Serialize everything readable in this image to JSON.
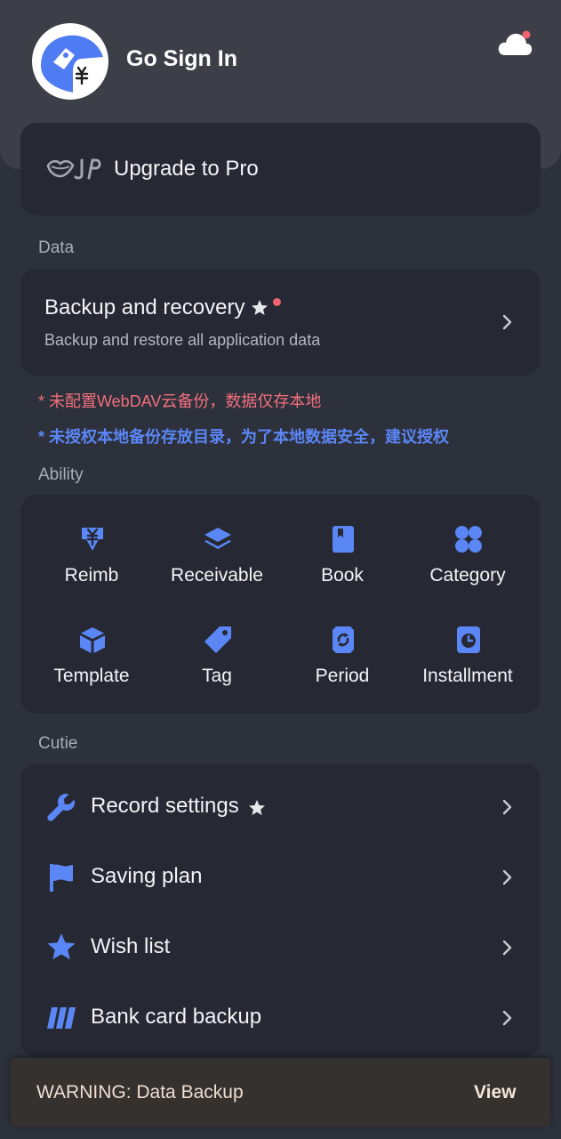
{
  "header": {
    "title": "Go Sign In",
    "avatar_icon": "bird-yen-logo-icon",
    "cloud_icon": "cloud-icon",
    "badge_color": "#f0626f"
  },
  "pro": {
    "label": "Upgrade to Pro",
    "logo_icon": "vip-lips-logo-icon"
  },
  "sections": {
    "data": "Data",
    "ability": "Ability",
    "cutie": "Cutie"
  },
  "backup": {
    "title": "Backup and recovery",
    "subtitle": "Backup and restore all application data"
  },
  "notices": {
    "webdav": "* 未配置WebDAV云备份，数据仅存本地",
    "local": "* 未授权本地备份存放目录，为了本地数据安全，建议授权"
  },
  "ability_items": [
    {
      "label": "Reimb",
      "icon": "yen-down-icon"
    },
    {
      "label": "Receivable",
      "icon": "layers-icon"
    },
    {
      "label": "Book",
      "icon": "book-icon"
    },
    {
      "label": "Category",
      "icon": "four-circles-icon"
    },
    {
      "label": "Template",
      "icon": "cube-icon"
    },
    {
      "label": "Tag",
      "icon": "tag-icon"
    },
    {
      "label": "Period",
      "icon": "period-refresh-icon"
    },
    {
      "label": "Installment",
      "icon": "clock-page-icon"
    }
  ],
  "cutie_items": [
    {
      "label": "Record settings",
      "icon": "wrench-icon"
    },
    {
      "label": "Saving plan",
      "icon": "flag-icon"
    },
    {
      "label": "Wish list",
      "icon": "star-icon"
    },
    {
      "label": "Bank card backup",
      "icon": "card-stack-icon"
    }
  ],
  "snackbar": {
    "message": "WARNING: Data Backup",
    "action": "View"
  },
  "colors": {
    "accent": "#5b86f5",
    "background": "#2d313c",
    "card": "#262933",
    "header": "#3c3f47",
    "warning_text": "#f0707c"
  }
}
